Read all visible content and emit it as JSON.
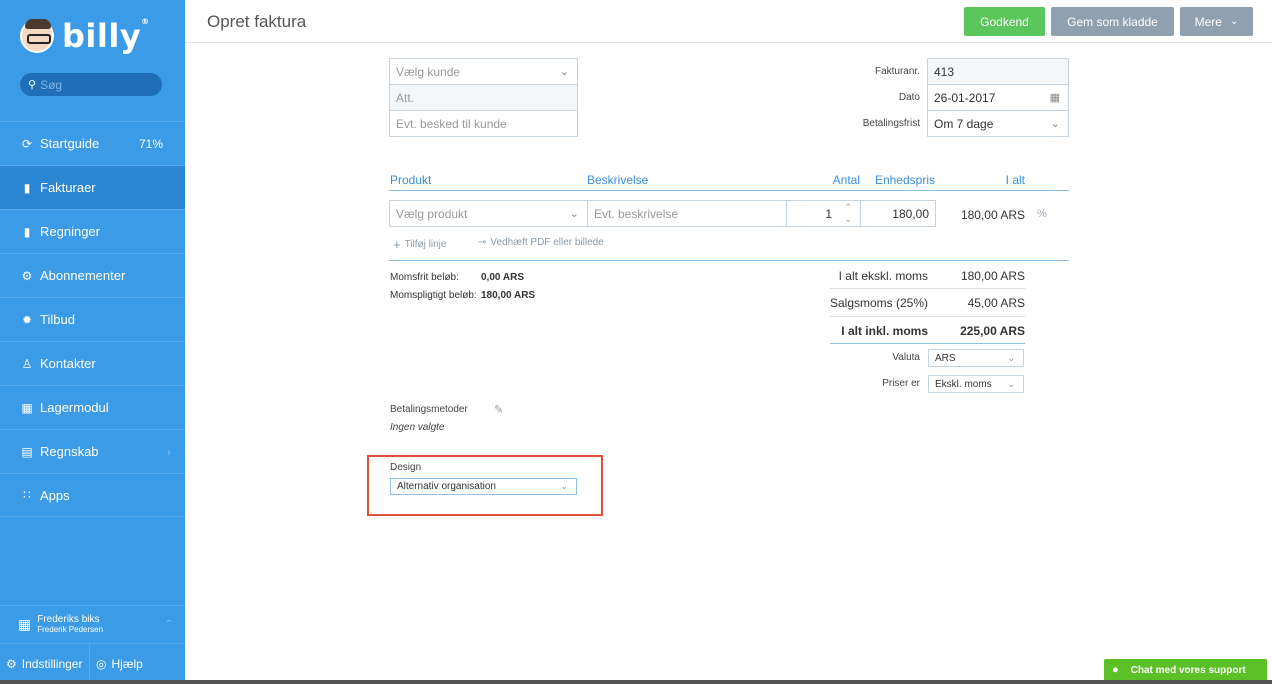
{
  "app": {
    "logo_text": "billy",
    "trademark": "®"
  },
  "sidebar": {
    "search_placeholder": "Søg",
    "items": [
      {
        "label": "Startguide",
        "icon": "progress-icon",
        "badge": "71%"
      },
      {
        "label": "Fakturaer",
        "icon": "invoice-icon",
        "active": true
      },
      {
        "label": "Regninger",
        "icon": "bill-icon"
      },
      {
        "label": "Abonnementer",
        "icon": "subscription-icon"
      },
      {
        "label": "Tilbud",
        "icon": "offer-icon"
      },
      {
        "label": "Kontakter",
        "icon": "contacts-icon"
      },
      {
        "label": "Lagermodul",
        "icon": "inventory-icon"
      },
      {
        "label": "Regnskab",
        "icon": "accounting-icon",
        "has_submenu": true
      },
      {
        "label": "Apps",
        "icon": "apps-icon"
      }
    ],
    "org": {
      "name": "Frederiks biks",
      "user": "Frederik Pedersen"
    },
    "settings_label": "Indstillinger",
    "help_label": "Hjælp"
  },
  "header": {
    "title": "Opret faktura",
    "approve_label": "Godkend",
    "draft_label": "Gem som kladde",
    "more_label": "Mere"
  },
  "customer": {
    "customer_placeholder": "Vælg kunde",
    "att_placeholder": "Att.",
    "message_placeholder": "Evt. besked til kunde"
  },
  "meta": {
    "invoice_no_label": "Fakturanr.",
    "invoice_no": "413",
    "date_label": "Dato",
    "date": "26-01-2017",
    "due_label": "Betalingsfrist",
    "due": "Om 7 dage"
  },
  "lines": {
    "headers": {
      "product": "Produkt",
      "description": "Beskrivelse",
      "qty": "Antal",
      "unit_price": "Enhedspris",
      "total": "I alt"
    },
    "row": {
      "product_placeholder": "Vælg produkt",
      "description_placeholder": "Evt. beskrivelse",
      "qty": "1",
      "unit_price": "180,00",
      "total": "180,00 ARS",
      "discount_symbol": "%"
    },
    "add_line_label": "Tilføj linje",
    "attach_label": "Vedhæft PDF eller billede"
  },
  "vat_info": {
    "free_label": "Momsfrit beløb:",
    "free_value": "0,00 ARS",
    "liable_label": "Momspligtigt beløb:",
    "liable_value": "180,00 ARS"
  },
  "totals": {
    "excl_label": "I alt ekskl. moms",
    "excl_value": "180,00 ARS",
    "vat_label": "Salgsmoms (25%)",
    "vat_value": "45,00 ARS",
    "incl_label": "I alt inkl. moms",
    "incl_value": "225,00 ARS",
    "currency_label": "Valuta",
    "currency": "ARS",
    "prices_label": "Priser er",
    "prices": "Ekskl. moms"
  },
  "payment": {
    "label": "Betalingsmetoder",
    "value": "Ingen valgte"
  },
  "design": {
    "label": "Design",
    "value": "Alternativ organisation"
  },
  "chat": {
    "label": "Chat med vores support"
  },
  "colors": {
    "sidebar": "#3c9be6",
    "active": "#2a85d3",
    "approve": "#5bc65b",
    "secondary": "#8fa0b0",
    "accent": "#3c8fd6",
    "highlight": "#e0523a",
    "chat": "#5bc026"
  }
}
